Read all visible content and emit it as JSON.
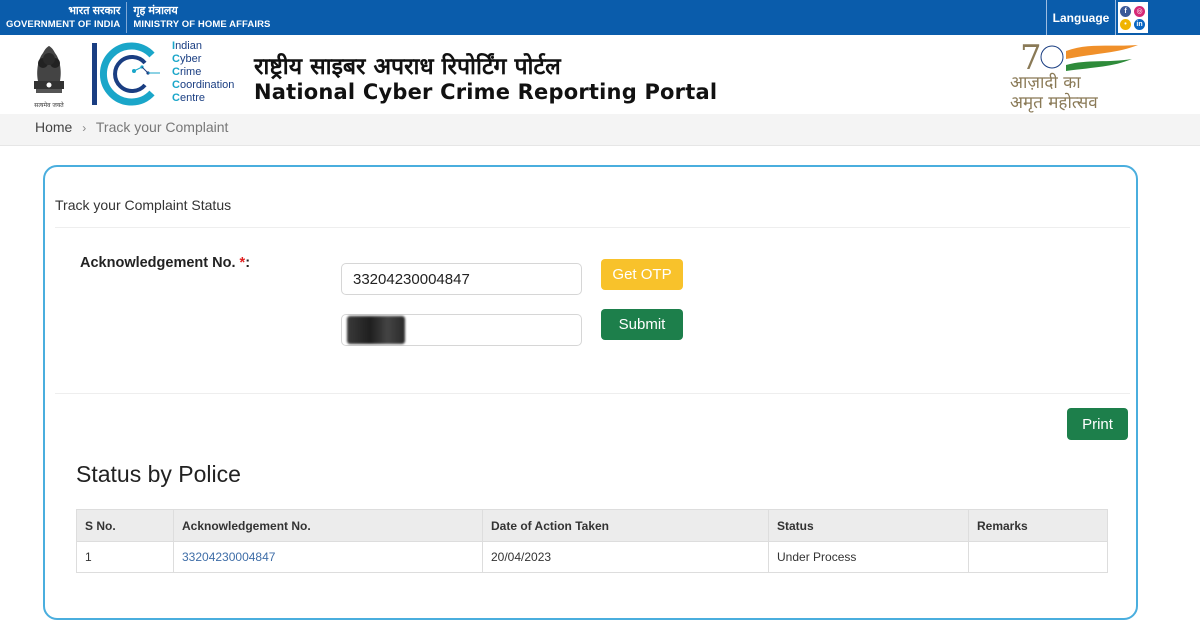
{
  "gov_strip": {
    "gov_hi": "भारत सरकार",
    "gov_en": "GOVERNMENT OF INDIA",
    "ministry_hi": "गृह मंत्रालय",
    "ministry_en": "MINISTRY OF HOME AFFAIRS",
    "language_label": "Language",
    "social_icons": [
      "facebook-icon",
      "instagram-icon",
      "koo-icon",
      "linkedin-icon"
    ]
  },
  "header": {
    "emblem_motto": "सत्यमेव जयते",
    "i4c_lines": [
      {
        "cap": "I",
        "rest": "ndian"
      },
      {
        "cap": "C",
        "rest": "yber"
      },
      {
        "cap": "C",
        "rest": "rime"
      },
      {
        "cap": "C",
        "rest": "oordination"
      },
      {
        "cap": "C",
        "rest": "entre"
      }
    ],
    "portal_title_hi": "राष्ट्रीय साइबर अपराध रिपोर्टिंग पोर्टल",
    "portal_title_en": "National Cyber Crime Reporting Portal",
    "azadi_line1": "आज़ादी का",
    "azadi_line2": "अमृत महोत्सव"
  },
  "breadcrumb": {
    "home": "Home",
    "separator": "›",
    "current": "Track your Complaint"
  },
  "form": {
    "card_title": "Track your Complaint Status",
    "ack_label": "Acknowledgement No.",
    "required_mark": "*",
    "label_suffix": ":",
    "ack_value": "33204230004847",
    "otp_value": "",
    "get_otp_label": "Get OTP",
    "submit_label": "Submit",
    "print_label": "Print"
  },
  "status": {
    "title": "Status by Police",
    "columns": [
      "S No.",
      "Acknowledgement No.",
      "Date of Action Taken",
      "Status",
      "Remarks"
    ],
    "rows": [
      {
        "sno": "1",
        "ack": "33204230004847",
        "date": "20/04/2023",
        "status": "Under Process",
        "remarks": ""
      }
    ]
  },
  "colors": {
    "gov_strip_bg": "#0a5cab",
    "card_border": "#4aaede",
    "otp_button": "#f8c22b",
    "submit_button": "#1d7f4b",
    "link": "#3f6ea8"
  }
}
